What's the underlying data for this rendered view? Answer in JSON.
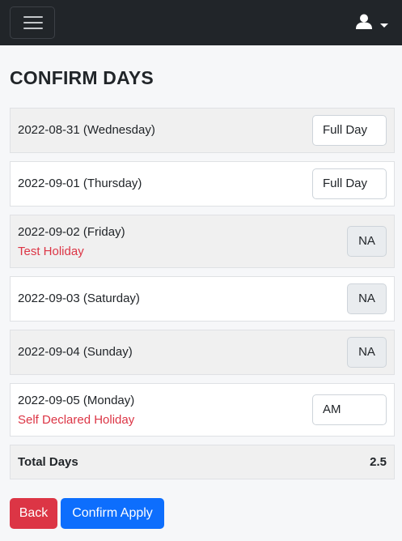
{
  "navbar": {
    "menu_icon": "hamburger-icon",
    "user_icon": "user-icon",
    "user_caret_icon": "caret-down-icon",
    "background": "#212529"
  },
  "page": {
    "title": "CONFIRM DAYS"
  },
  "days": [
    {
      "date": "2022-08-31 (Wednesday)",
      "note": "",
      "selection": "Full Day",
      "editable": true,
      "shaded": true
    },
    {
      "date": "2022-09-01 (Thursday)",
      "note": "",
      "selection": "Full Day",
      "editable": true,
      "shaded": false
    },
    {
      "date": "2022-09-02 (Friday)",
      "note": "Test Holiday",
      "selection": "NA",
      "editable": false,
      "shaded": true
    },
    {
      "date": "2022-09-03 (Saturday)",
      "note": "",
      "selection": "NA",
      "editable": false,
      "shaded": false
    },
    {
      "date": "2022-09-04 (Sunday)",
      "note": "",
      "selection": "NA",
      "editable": false,
      "shaded": true
    },
    {
      "date": "2022-09-05 (Monday)",
      "note": "Self Declared Holiday",
      "selection": "AM",
      "editable": true,
      "shaded": false
    }
  ],
  "total": {
    "label": "Total Days",
    "value": "2.5"
  },
  "actions": {
    "back_label": "Back",
    "confirm_label": "Confirm Apply"
  },
  "colors": {
    "danger": "#dc3545",
    "primary": "#0d6efd",
    "holiday_text": "#dc3545"
  }
}
